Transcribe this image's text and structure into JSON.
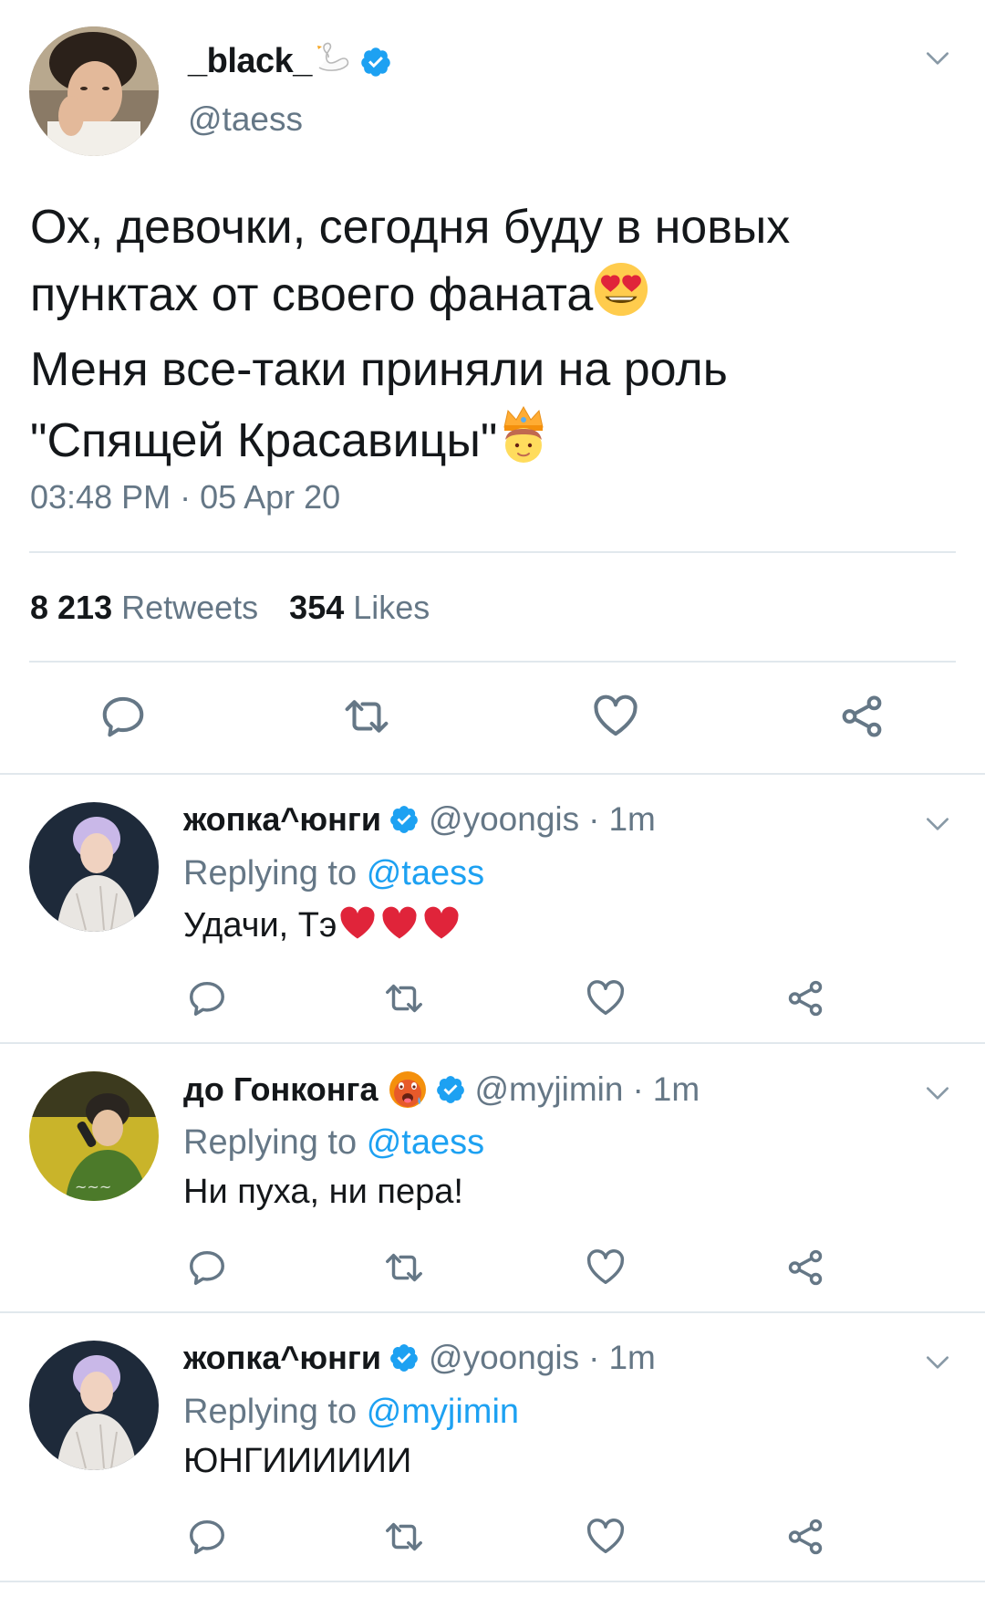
{
  "colors": {
    "text": "#14171a",
    "secondary": "#657786",
    "accent": "#1da1f2",
    "divider": "#e1e8ed",
    "verified": "#1da1f2"
  },
  "main_tweet": {
    "display_name": "_black_",
    "name_emoji": "swan",
    "verified": true,
    "handle": "@taess",
    "text_lines": [
      "Ох, девочки, сегодня буду в новых",
      "пунктах от своего фаната",
      "Меня все-таки приняли на роль",
      "\"Спящей Красавицы\""
    ],
    "emojis": [
      "heart-eyes-emoji",
      "prince-emoji"
    ],
    "timestamp": "03:48 PM · 05 Apr 20",
    "retweets_count": "8 213",
    "retweets_label": "Retweets",
    "likes_count": "354",
    "likes_label": "Likes",
    "actions": [
      "reply-icon",
      "retweet-icon",
      "like-icon",
      "share-icon"
    ]
  },
  "replies": [
    {
      "display_name": "жопка^юнги",
      "verified": true,
      "handle": "@yoongis",
      "separator": "·",
      "time": "1m",
      "replying_prefix": "Replying to",
      "replying_to": "@taess",
      "text": "Удачи, Тэ",
      "trailing_emoji": "three-red-hearts"
    },
    {
      "display_name": "до Гонконга",
      "name_emoji": "hot-face-emoji",
      "verified": true,
      "handle": "@myjimin",
      "separator": "·",
      "time": "1m",
      "replying_prefix": "Replying to",
      "replying_to": "@taess",
      "text": "Ни пуха, ни пера!"
    },
    {
      "display_name": "жопка^юнги",
      "verified": true,
      "handle": "@yoongis",
      "separator": "·",
      "time": "1m",
      "replying_prefix": "Replying to",
      "replying_to": "@myjimin",
      "text": "ЮНГИИИИИИ"
    }
  ]
}
